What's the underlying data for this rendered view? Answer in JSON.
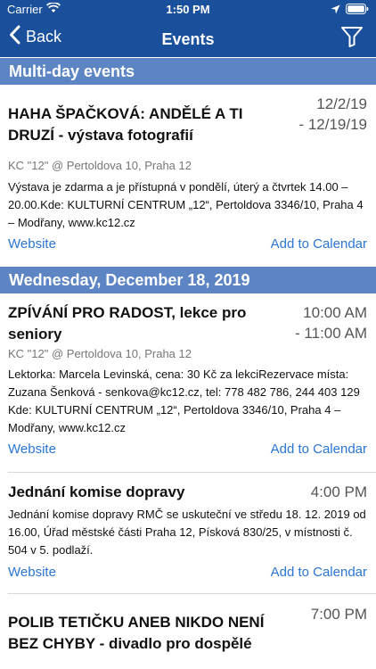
{
  "status_bar": {
    "carrier": "Carrier",
    "time": "1:50 PM"
  },
  "nav": {
    "back_label": "Back",
    "title": "Events"
  },
  "sections": [
    {
      "label": "Multi-day events"
    },
    {
      "label": "Wednesday, December 18, 2019"
    }
  ],
  "events": [
    {
      "title": "HAHA ŠPAČKOVÁ: ANDĚLÉ A TI DRUZÍ - výstava fotografií",
      "time_line1": "12/2/19",
      "time_line2": "- 12/19/19",
      "location": "KC \"12\" @ Pertoldova 10, Praha 12",
      "description": "Výstava je zdarma a je přístupná v pondělí, úterý a čtvrtek 14.00 – 20.00.Kde: KULTURNÍ CENTRUM „12“, Pertoldova 3346/10, Praha 4 – Modřany, www.kc12.cz",
      "website_label": "Website",
      "calendar_label": "Add to Calendar"
    },
    {
      "title": "ZPÍVÁNÍ PRO RADOST, lekce pro seniory",
      "time_line1": "10:00 AM",
      "time_line2": "- 11:00 AM",
      "location": "KC \"12\" @ Pertoldova 10, Praha 12",
      "description": "Lektorka: Marcela Levinská, cena: 30 Kč za lekciRezervace místa: Zuzana Šenková  - senkova@kc12.cz, tel: 778 482 786, 244 403 129  Kde: KULTURNÍ CENTRUM „12“, Pertoldova 3346/10, Praha 4 – Modřany, www.kc12.cz",
      "website_label": "Website",
      "calendar_label": "Add to Calendar"
    },
    {
      "title": "Jednání komise dopravy",
      "time_line1": "4:00 PM",
      "description": "Jednání komise dopravy RMČ se uskuteční ve středu 18. 12. 2019 od 16.00, Úřad městské části Praha 12, Písková 830/25, v místnosti č. 504 v 5. podlaží.",
      "website_label": "Website",
      "calendar_label": "Add to Calendar"
    },
    {
      "title": "POLIB TETIČKU ANEB NIKDO NENÍ BEZ CHYBY - divadlo pro dospělé",
      "time_line1": "7:00 PM"
    }
  ],
  "icons": {
    "wifi": "wifi-icon",
    "location": "location-arrow-icon",
    "battery": "battery-icon",
    "back": "chevron-left-icon",
    "filter": "filter-icon"
  },
  "colors": {
    "nav_bar": "#1a4f9c",
    "section_header": "#5d85c4",
    "link": "#2a76d2"
  }
}
